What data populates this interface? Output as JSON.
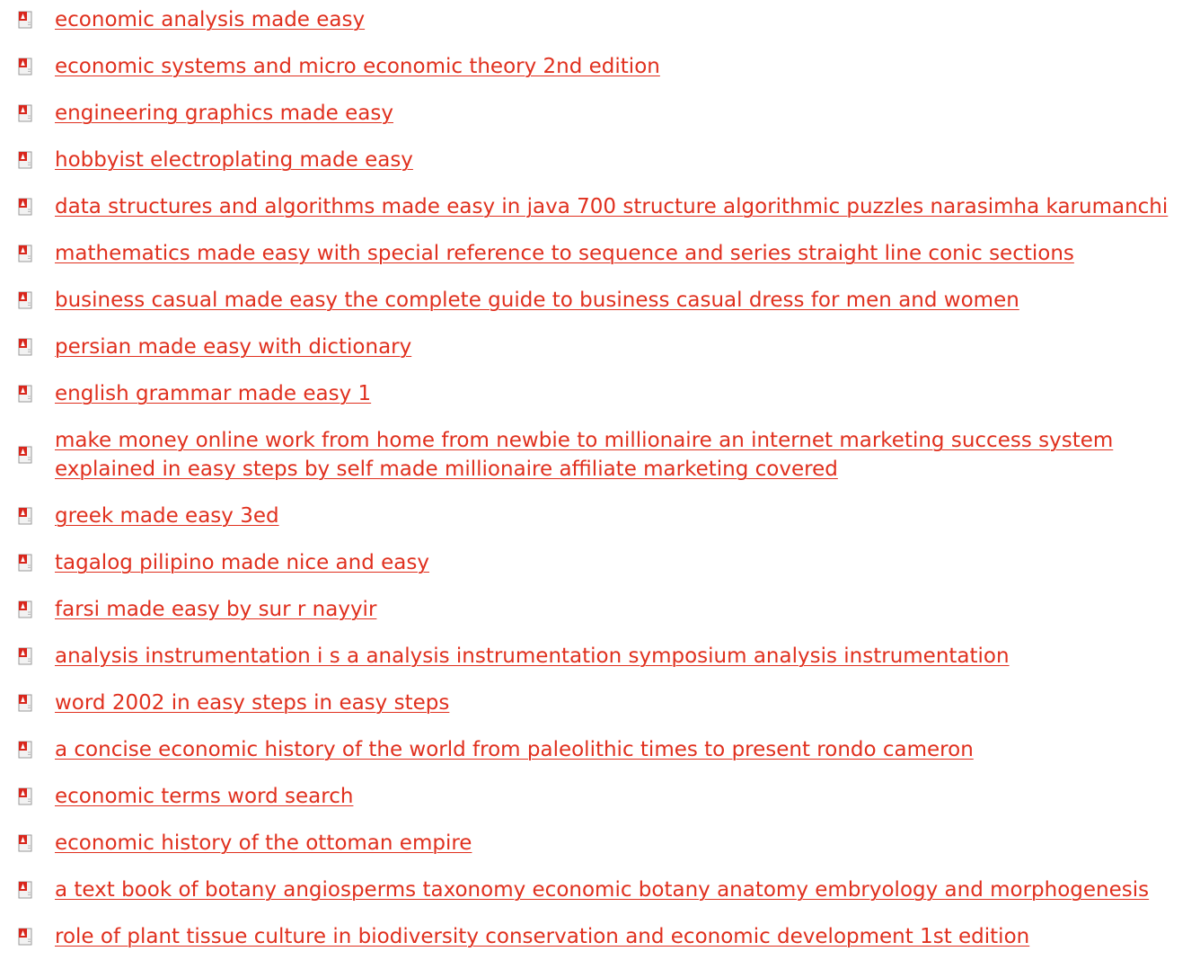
{
  "links": [
    {
      "title": "economic analysis made easy",
      "icon": "pdf-file-icon"
    },
    {
      "title": "economic systems and micro economic theory 2nd edition",
      "icon": "pdf-file-icon"
    },
    {
      "title": "engineering graphics made easy",
      "icon": "pdf-file-icon"
    },
    {
      "title": "hobbyist electroplating made easy",
      "icon": "pdf-file-icon"
    },
    {
      "title": "data structures and algorithms made easy in java 700 structure algorithmic puzzles narasimha karumanchi",
      "icon": "pdf-file-icon"
    },
    {
      "title": "mathematics made easy with special reference to sequence and series straight line conic sections",
      "icon": "pdf-file-icon"
    },
    {
      "title": "business casual made easy the complete guide to business casual dress for men and women",
      "icon": "pdf-file-icon"
    },
    {
      "title": "persian made easy with dictionary",
      "icon": "pdf-file-icon"
    },
    {
      "title": "english grammar made easy 1",
      "icon": "pdf-file-icon"
    },
    {
      "title": "make money online work from home from newbie to millionaire an internet marketing success system explained in easy steps by self made millionaire affiliate marketing covered",
      "icon": "pdf-file-icon"
    },
    {
      "title": "greek made easy 3ed",
      "icon": "pdf-file-icon"
    },
    {
      "title": "tagalog pilipino made nice and easy",
      "icon": "pdf-file-icon"
    },
    {
      "title": "farsi made easy by sur r nayyir",
      "icon": "pdf-file-icon"
    },
    {
      "title": "analysis instrumentation i s a analysis instrumentation symposium analysis instrumentation",
      "icon": "pdf-file-icon"
    },
    {
      "title": "word 2002 in easy steps in easy steps",
      "icon": "pdf-file-icon"
    },
    {
      "title": "a concise economic history of the world from paleolithic times to present rondo cameron",
      "icon": "pdf-file-icon"
    },
    {
      "title": "economic terms word search",
      "icon": "pdf-file-icon"
    },
    {
      "title": "economic history of the ottoman empire",
      "icon": "pdf-file-icon"
    },
    {
      "title": "a text book of botany angiosperms taxonomy economic botany anatomy embryology and morphogenesis",
      "icon": "pdf-file-icon"
    },
    {
      "title": "role of plant tissue culture in biodiversity conservation and economic development 1st edition",
      "icon": "pdf-file-icon"
    }
  ],
  "colors": {
    "link": "#e0301e",
    "icon_red": "#d9261c",
    "background": "#ffffff"
  }
}
